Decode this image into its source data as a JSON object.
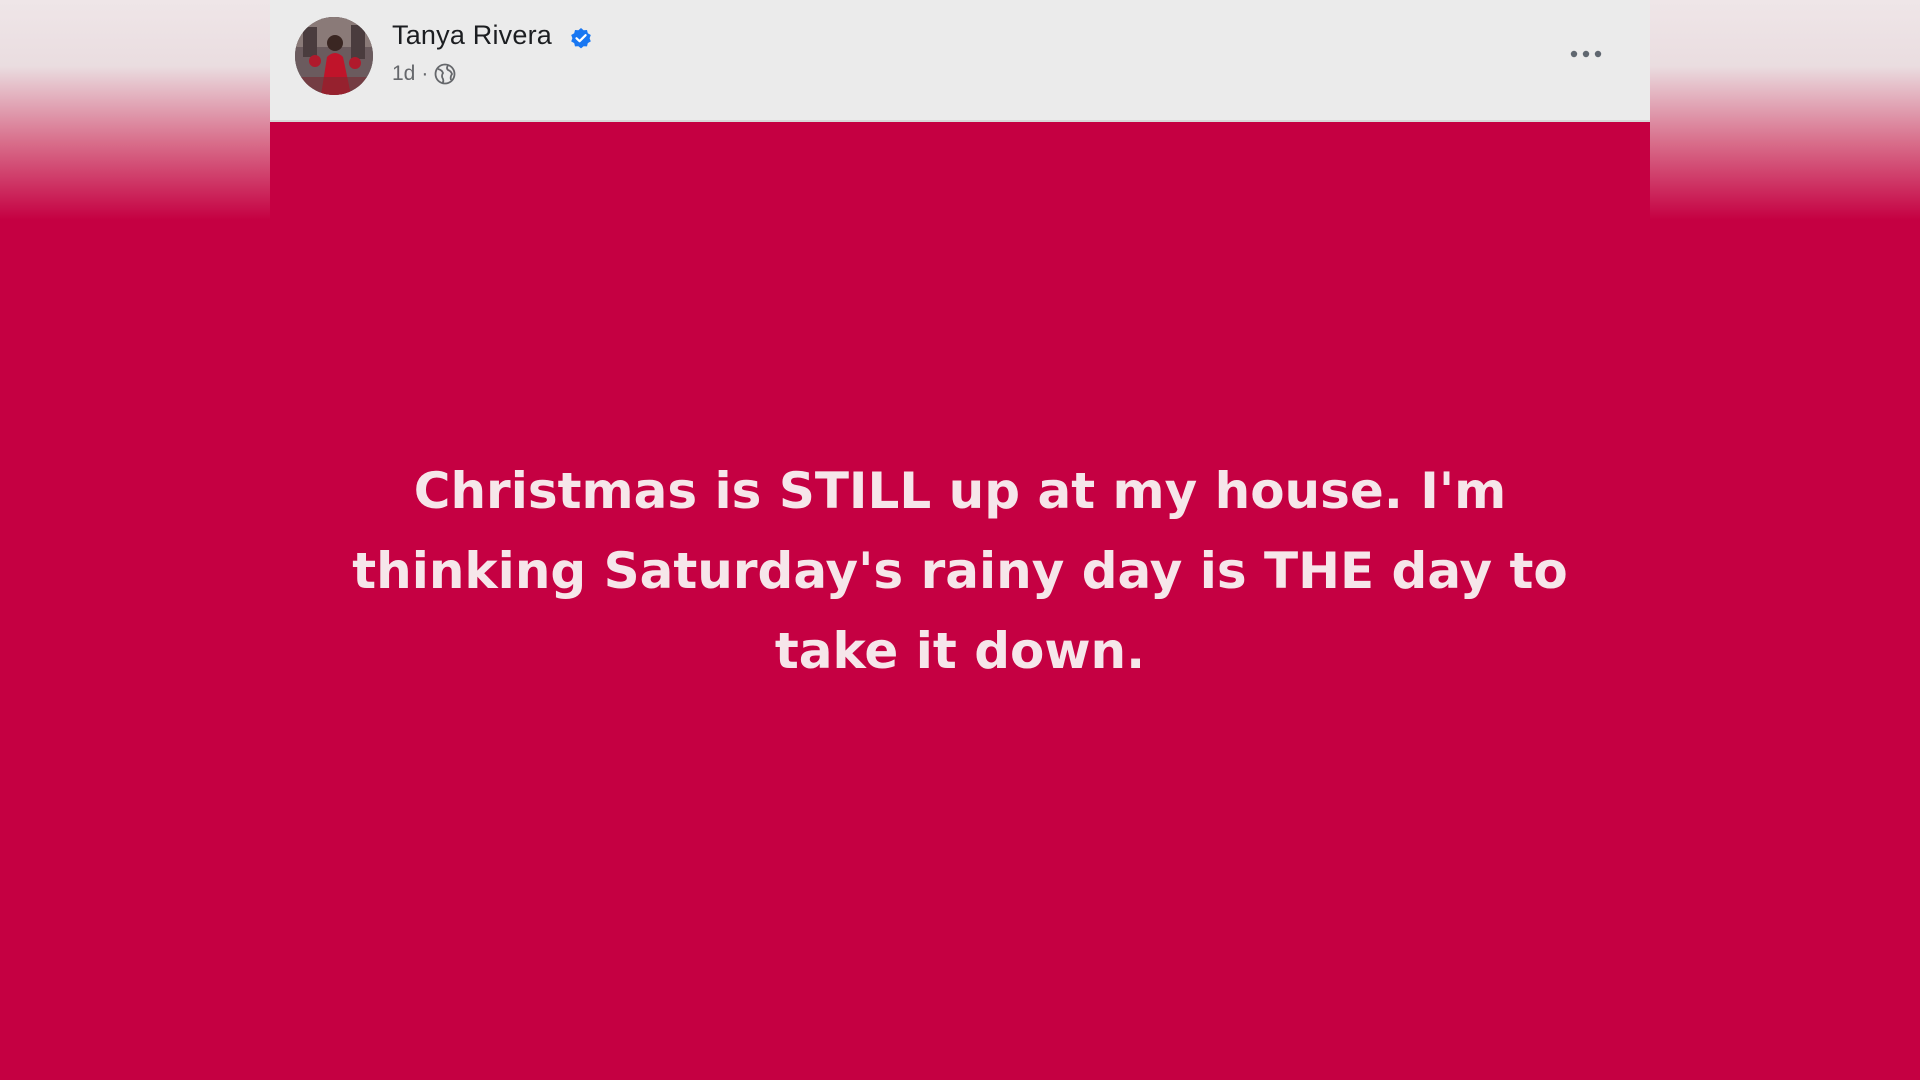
{
  "post": {
    "author": {
      "name": "Tanya Rivera",
      "verified": true
    },
    "timestamp": "1d",
    "separator": "·",
    "audience_icon": "globe-icon",
    "more_options_icon": "more-options-icon",
    "text": "Christmas is STILL up at my house. I'm thinking Saturday's rainy day is THE day to take it down.",
    "background_color": "#c50042",
    "text_color": "#f6e6ea"
  },
  "colors": {
    "header_bg": "#ebebeb",
    "verified_blue": "#1877f2",
    "meta_gray": "#65676b"
  }
}
